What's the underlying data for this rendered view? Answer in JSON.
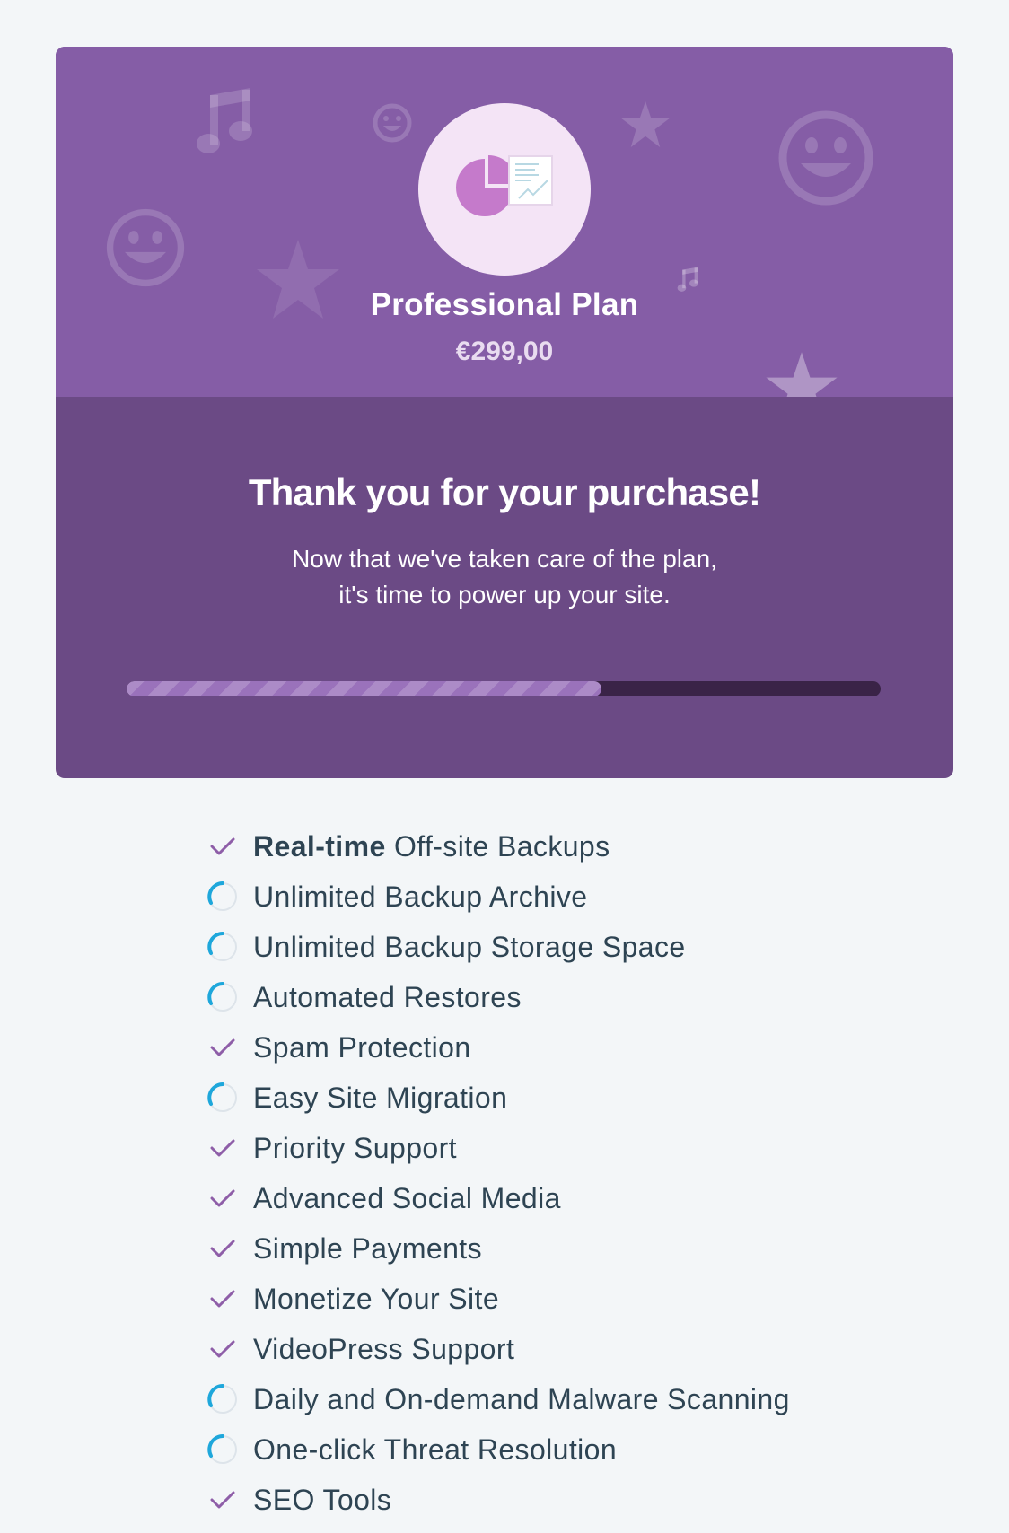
{
  "colors": {
    "page_bg": "#f3f6f8",
    "header_purple": "#855da6",
    "body_purple": "#6b4a85",
    "check": "#8e5ea8",
    "spinner": "#1ea7db",
    "text": "#2e4453"
  },
  "plan": {
    "icon": "plan-chart-document-icon",
    "name": "Professional Plan",
    "price": "€299,00"
  },
  "thanks": {
    "title": "Thank you for your purchase!",
    "line1": "Now that we've taken care of the plan,",
    "line2": "it's time to power up your site."
  },
  "progress": {
    "fraction": 0.63
  },
  "features": [
    {
      "status": "done",
      "icon": "checkmark-icon",
      "strong": "Real-time",
      "label": " Off-site Backups"
    },
    {
      "status": "pending",
      "icon": "spinner-icon",
      "strong": "",
      "label": "Unlimited Backup Archive"
    },
    {
      "status": "pending",
      "icon": "spinner-icon",
      "strong": "",
      "label": "Unlimited Backup Storage Space"
    },
    {
      "status": "pending",
      "icon": "spinner-icon",
      "strong": "",
      "label": "Automated Restores"
    },
    {
      "status": "done",
      "icon": "checkmark-icon",
      "strong": "",
      "label": "Spam Protection"
    },
    {
      "status": "pending",
      "icon": "spinner-icon",
      "strong": "",
      "label": "Easy Site Migration"
    },
    {
      "status": "done",
      "icon": "checkmark-icon",
      "strong": "",
      "label": "Priority Support"
    },
    {
      "status": "done",
      "icon": "checkmark-icon",
      "strong": "",
      "label": "Advanced Social Media"
    },
    {
      "status": "done",
      "icon": "checkmark-icon",
      "strong": "",
      "label": "Simple Payments"
    },
    {
      "status": "done",
      "icon": "checkmark-icon",
      "strong": "",
      "label": "Monetize Your Site"
    },
    {
      "status": "done",
      "icon": "checkmark-icon",
      "strong": "",
      "label": "VideoPress Support"
    },
    {
      "status": "pending",
      "icon": "spinner-icon",
      "strong": "",
      "label": "Daily and On-demand Malware Scanning"
    },
    {
      "status": "pending",
      "icon": "spinner-icon",
      "strong": "",
      "label": "One-click Threat Resolution"
    },
    {
      "status": "done",
      "icon": "checkmark-icon",
      "strong": "",
      "label": "SEO Tools"
    }
  ]
}
